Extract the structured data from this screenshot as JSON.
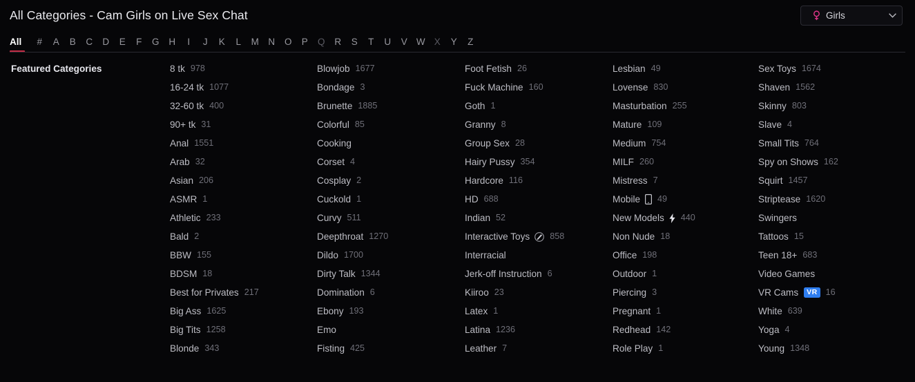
{
  "header": {
    "title": "All Categories - Cam Girls on Live Sex Chat",
    "gender_select": {
      "value": "Girls",
      "icon": "venus-icon",
      "chevron": "chevron-down-icon"
    }
  },
  "alphabet_nav": {
    "active": "All",
    "items": [
      {
        "label": "All",
        "state": "active"
      },
      {
        "label": "#",
        "state": "normal"
      },
      {
        "label": "A",
        "state": "normal"
      },
      {
        "label": "B",
        "state": "normal"
      },
      {
        "label": "C",
        "state": "normal"
      },
      {
        "label": "D",
        "state": "normal"
      },
      {
        "label": "E",
        "state": "normal"
      },
      {
        "label": "F",
        "state": "normal"
      },
      {
        "label": "G",
        "state": "normal"
      },
      {
        "label": "H",
        "state": "normal"
      },
      {
        "label": "I",
        "state": "normal"
      },
      {
        "label": "J",
        "state": "normal"
      },
      {
        "label": "K",
        "state": "normal"
      },
      {
        "label": "L",
        "state": "normal"
      },
      {
        "label": "M",
        "state": "normal"
      },
      {
        "label": "N",
        "state": "normal"
      },
      {
        "label": "O",
        "state": "normal"
      },
      {
        "label": "P",
        "state": "normal"
      },
      {
        "label": "Q",
        "state": "dim"
      },
      {
        "label": "R",
        "state": "normal"
      },
      {
        "label": "S",
        "state": "normal"
      },
      {
        "label": "T",
        "state": "normal"
      },
      {
        "label": "U",
        "state": "normal"
      },
      {
        "label": "V",
        "state": "normal"
      },
      {
        "label": "W",
        "state": "normal"
      },
      {
        "label": "X",
        "state": "dim"
      },
      {
        "label": "Y",
        "state": "normal"
      },
      {
        "label": "Z",
        "state": "normal"
      }
    ]
  },
  "featured": {
    "label": "Featured Categories"
  },
  "colors": {
    "accent_underline": "#c42d46",
    "venus_icon": "#e2348a",
    "vr_badge_bg": "#2f7ef0",
    "background": "#060608"
  },
  "columns": [
    {
      "items": [
        {
          "name": "8 tk",
          "count": "978"
        },
        {
          "name": "16-24 tk",
          "count": "1077"
        },
        {
          "name": "32-60 tk",
          "count": "400"
        },
        {
          "name": "90+ tk",
          "count": "31"
        },
        {
          "name": "Anal",
          "count": "1551"
        },
        {
          "name": "Arab",
          "count": "32"
        },
        {
          "name": "Asian",
          "count": "206"
        },
        {
          "name": "ASMR",
          "count": "1"
        },
        {
          "name": "Athletic",
          "count": "233"
        },
        {
          "name": "Bald",
          "count": "2"
        },
        {
          "name": "BBW",
          "count": "155"
        },
        {
          "name": "BDSM",
          "count": "18"
        },
        {
          "name": "Best for Privates",
          "count": "217"
        },
        {
          "name": "Big Ass",
          "count": "1625"
        },
        {
          "name": "Big Tits",
          "count": "1258"
        },
        {
          "name": "Blonde",
          "count": "343"
        }
      ]
    },
    {
      "items": [
        {
          "name": "Blowjob",
          "count": "1677"
        },
        {
          "name": "Bondage",
          "count": "3"
        },
        {
          "name": "Brunette",
          "count": "1885"
        },
        {
          "name": "Colorful",
          "count": "85"
        },
        {
          "name": "Cooking",
          "count": ""
        },
        {
          "name": "Corset",
          "count": "4"
        },
        {
          "name": "Cosplay",
          "count": "2"
        },
        {
          "name": "Cuckold",
          "count": "1"
        },
        {
          "name": "Curvy",
          "count": "511"
        },
        {
          "name": "Deepthroat",
          "count": "1270"
        },
        {
          "name": "Dildo",
          "count": "1700"
        },
        {
          "name": "Dirty Talk",
          "count": "1344"
        },
        {
          "name": "Domination",
          "count": "6"
        },
        {
          "name": "Ebony",
          "count": "193"
        },
        {
          "name": "Emo",
          "count": ""
        },
        {
          "name": "Fisting",
          "count": "425"
        }
      ]
    },
    {
      "items": [
        {
          "name": "Foot Fetish",
          "count": "26"
        },
        {
          "name": "Fuck Machine",
          "count": "160"
        },
        {
          "name": "Goth",
          "count": "1"
        },
        {
          "name": "Granny",
          "count": "8"
        },
        {
          "name": "Group Sex",
          "count": "28"
        },
        {
          "name": "Hairy Pussy",
          "count": "354"
        },
        {
          "name": "Hardcore",
          "count": "116"
        },
        {
          "name": "HD",
          "count": "688"
        },
        {
          "name": "Indian",
          "count": "52"
        },
        {
          "name": "Interactive Toys",
          "count": "858",
          "icon": "vibrator-wand-icon"
        },
        {
          "name": "Interracial",
          "count": ""
        },
        {
          "name": "Jerk-off Instruction",
          "count": "6"
        },
        {
          "name": "Kiiroo",
          "count": "23"
        },
        {
          "name": "Latex",
          "count": "1"
        },
        {
          "name": "Latina",
          "count": "1236"
        },
        {
          "name": "Leather",
          "count": "7"
        }
      ]
    },
    {
      "items": [
        {
          "name": "Lesbian",
          "count": "49"
        },
        {
          "name": "Lovense",
          "count": "830"
        },
        {
          "name": "Masturbation",
          "count": "255"
        },
        {
          "name": "Mature",
          "count": "109"
        },
        {
          "name": "Medium",
          "count": "754"
        },
        {
          "name": "MILF",
          "count": "260"
        },
        {
          "name": "Mistress",
          "count": "7"
        },
        {
          "name": "Mobile",
          "count": "49",
          "icon": "mobile-phone-icon"
        },
        {
          "name": "New Models",
          "count": "440",
          "icon": "lightning-bolt-icon"
        },
        {
          "name": "Non Nude",
          "count": "18"
        },
        {
          "name": "Office",
          "count": "198"
        },
        {
          "name": "Outdoor",
          "count": "1"
        },
        {
          "name": "Piercing",
          "count": "3"
        },
        {
          "name": "Pregnant",
          "count": "1"
        },
        {
          "name": "Redhead",
          "count": "142"
        },
        {
          "name": "Role Play",
          "count": "1"
        }
      ]
    },
    {
      "items": [
        {
          "name": "Sex Toys",
          "count": "1674"
        },
        {
          "name": "Shaven",
          "count": "1562"
        },
        {
          "name": "Skinny",
          "count": "803"
        },
        {
          "name": "Slave",
          "count": "4"
        },
        {
          "name": "Small Tits",
          "count": "764"
        },
        {
          "name": "Spy on Shows",
          "count": "162"
        },
        {
          "name": "Squirt",
          "count": "1457"
        },
        {
          "name": "Striptease",
          "count": "1620"
        },
        {
          "name": "Swingers",
          "count": ""
        },
        {
          "name": "Tattoos",
          "count": "15"
        },
        {
          "name": "Teen 18+",
          "count": "683"
        },
        {
          "name": "Video Games",
          "count": ""
        },
        {
          "name": "VR Cams",
          "count": "16",
          "badge": "VR"
        },
        {
          "name": "White",
          "count": "639"
        },
        {
          "name": "Yoga",
          "count": "4"
        },
        {
          "name": "Young",
          "count": "1348"
        }
      ]
    }
  ]
}
